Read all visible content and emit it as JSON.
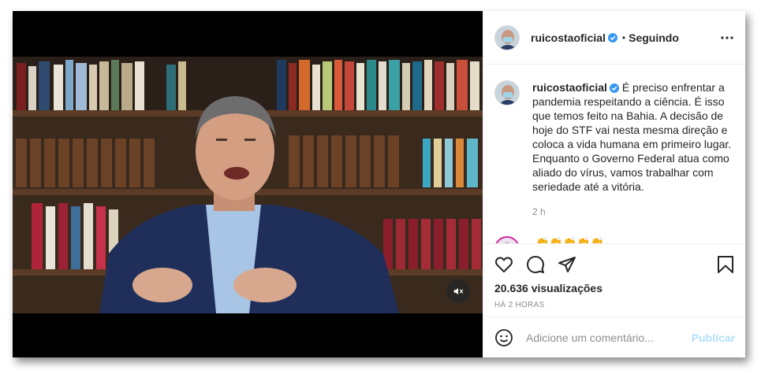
{
  "post": {
    "username": "ruicostaoficial",
    "follow_separator": "•",
    "follow_state": "Seguindo",
    "caption": "É preciso enfrentar a pandemia respeitando a ciência. É isso que temos feito na Bahia. A decisão de hoje do STF vai nesta mesma direção e coloca a vida humana em primeiro lugar. Enquanto o Governo Federal atua como aliado do vírus, vamos trabalhar com seriedade até a vitória.",
    "caption_time": "2 h",
    "views": "20.636 visualizações",
    "posted_ago": "HÁ 2 HORAS"
  },
  "comment2": {
    "username": "",
    "text": "👏👏👏👏👏"
  },
  "comment_form": {
    "placeholder": "Adicione um comentário...",
    "submit_label": "Publicar"
  },
  "colors": {
    "verified": "#3897f0",
    "link_disabled": "#b2dffc",
    "muted_text": "#8e8e8e"
  },
  "icons": [
    "verified-icon",
    "more-icon",
    "heart-icon",
    "comment-icon",
    "share-icon",
    "save-icon",
    "emoji-icon",
    "mute-icon"
  ]
}
